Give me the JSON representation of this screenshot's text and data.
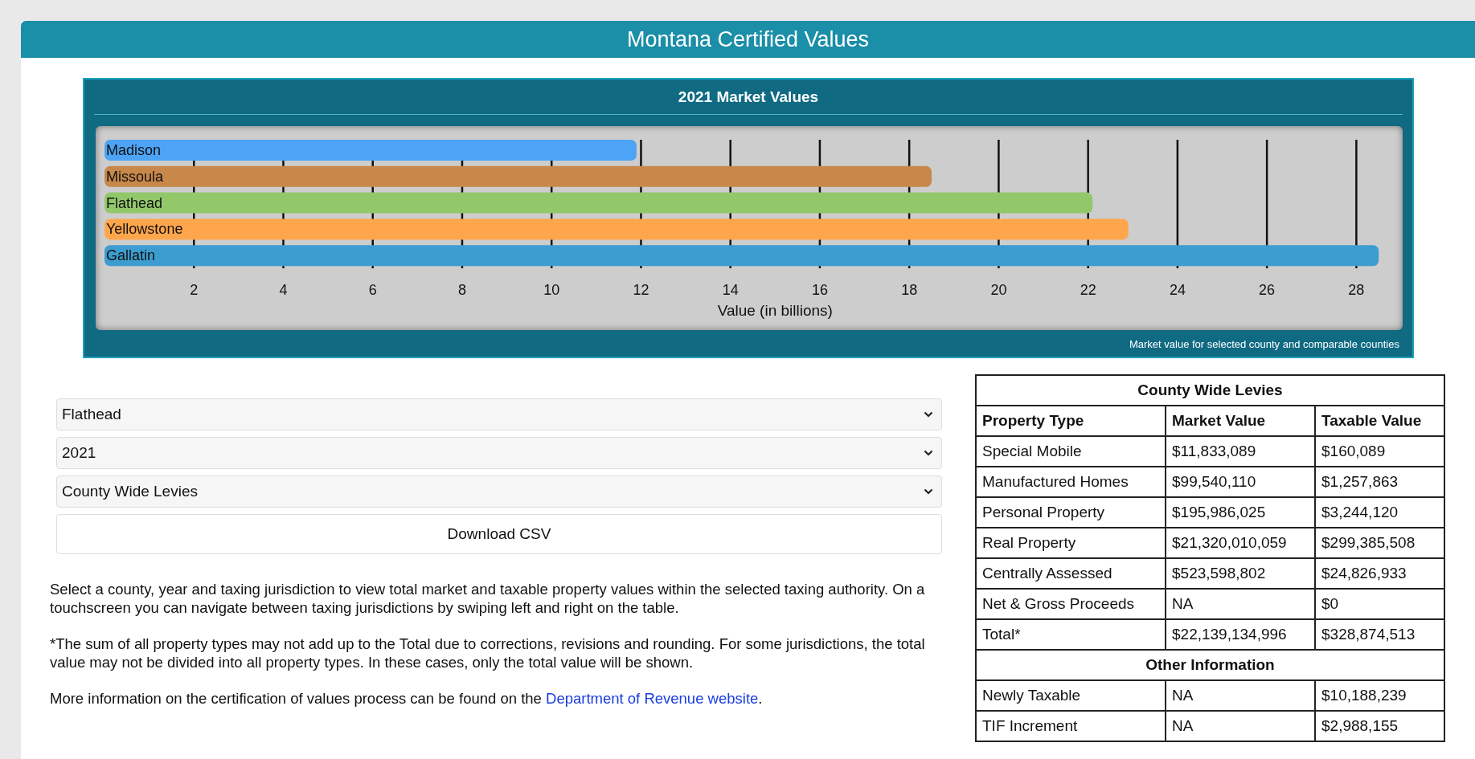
{
  "header": {
    "title": "Montana Certified Values"
  },
  "chart_panel": {
    "title": "2021 Market Values",
    "caption": "Market value for selected county and comparable counties",
    "chart_data": {
      "type": "bar",
      "orientation": "horizontal",
      "xlabel": "Value (in billions)",
      "xlim": [
        0,
        29
      ],
      "xticks": [
        2,
        4,
        6,
        8,
        10,
        12,
        14,
        16,
        18,
        20,
        22,
        24,
        26,
        28
      ],
      "grid": true,
      "series": [
        {
          "name": "Madison",
          "color": "#4da3f5",
          "values": [
            11.9
          ]
        },
        {
          "name": "Missoula",
          "color": "#c8884a",
          "values": [
            18.5
          ]
        },
        {
          "name": "Flathead",
          "color": "#92c86a",
          "values": [
            22.1
          ]
        },
        {
          "name": "Yellowstone",
          "color": "#ffa64d",
          "values": [
            22.9
          ]
        },
        {
          "name": "Gallatin",
          "color": "#3d9dd0",
          "values": [
            28.5
          ]
        }
      ]
    }
  },
  "filters": [
    {
      "value": "Flathead"
    },
    {
      "value": "2021"
    },
    {
      "value": "County Wide Levies"
    }
  ],
  "download_button": "Download CSV",
  "notes": [
    {
      "text": "Select a county, year and taxing jurisdiction to view total market and taxable property values within the selected taxing authority. On a touchscreen you can navigate between taxing jurisdictions by swiping left and right on the table."
    },
    {
      "text": "*The sum of all property types may not add up to the Total due to corrections, revisions and rounding. For some jurisdictions, the total value may not be divided into all property types. In these cases, only the total value will be shown."
    },
    {
      "text": "More information on the certification of values process can be found on the ",
      "link": "Department of Revenue website",
      "after": "."
    }
  ],
  "table": {
    "title": "County Wide Levies",
    "columns": [
      "Property Type",
      "Market Value",
      "Taxable Value"
    ],
    "rows": [
      [
        "Special Mobile",
        "$11,833,089",
        "$160,089"
      ],
      [
        "Manufactured Homes",
        "$99,540,110",
        "$1,257,863"
      ],
      [
        "Personal Property",
        "$195,986,025",
        "$3,244,120"
      ],
      [
        "Real Property",
        "$21,320,010,059",
        "$299,385,508"
      ],
      [
        "Centrally Assessed",
        "$523,598,802",
        "$24,826,933"
      ],
      [
        "Net & Gross Proceeds",
        "NA",
        "$0"
      ],
      [
        "Total*",
        "$22,139,134,996",
        "$328,874,513"
      ]
    ],
    "section": "Other Information",
    "other_rows": [
      [
        "Newly Taxable",
        "NA",
        "$10,188,239"
      ],
      [
        "TIF Increment",
        "NA",
        "$2,988,155"
      ]
    ]
  }
}
